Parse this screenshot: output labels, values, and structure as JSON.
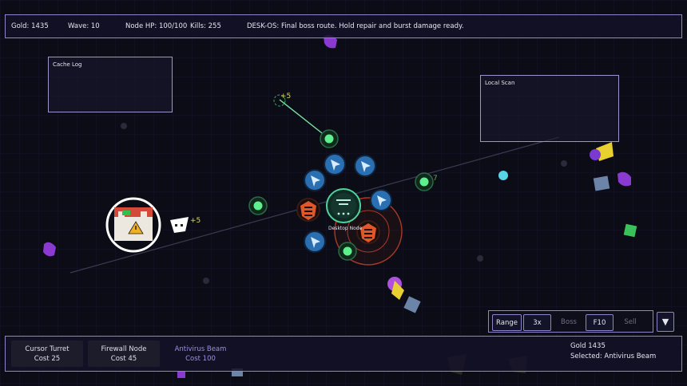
{
  "hud": {
    "gold": "Gold: 1435",
    "wave": "Wave: 10",
    "node_hp": "Node HP: 100/100",
    "kills": "Kills: 255",
    "message": "DESK-OS: Final boss route. Hold repair and burst damage ready."
  },
  "panels": {
    "cache_log": "Cache Log",
    "local_scan": "Local Scan"
  },
  "board": {
    "core_label": "Desktop Node",
    "float_plus_top": "+5",
    "float_plus_left": "+5",
    "float_seven": "7"
  },
  "actions": {
    "range": "Range",
    "speed": "3x",
    "boss": "Boss",
    "f10": "F10",
    "sell": "Sell",
    "collapse": "▼"
  },
  "towers": [
    {
      "name": "Cursor Turret",
      "cost": "Cost 25"
    },
    {
      "name": "Firewall Node",
      "cost": "Cost 45"
    },
    {
      "name": "Antivirus Beam",
      "cost": "Cost 100"
    }
  ],
  "status": {
    "gold": "Gold 1435",
    "selected": "Selected: Antivirus Beam"
  },
  "colors": {
    "background": "#0c0c16",
    "panel_border": "#8c86c8",
    "accent_purple": "#9a90e8",
    "cursor_turret": "#3a8ed0",
    "firewall": "#e0582a",
    "antivirus": "#3ee07a",
    "virus": "#8a3ad0",
    "core": "#4fd39a"
  },
  "icons": [
    "cursor-turret-icon",
    "firewall-node-icon",
    "antivirus-beam-icon",
    "desktop-node-icon",
    "virus-icon",
    "boss-virus-icon",
    "warning-icon"
  ]
}
